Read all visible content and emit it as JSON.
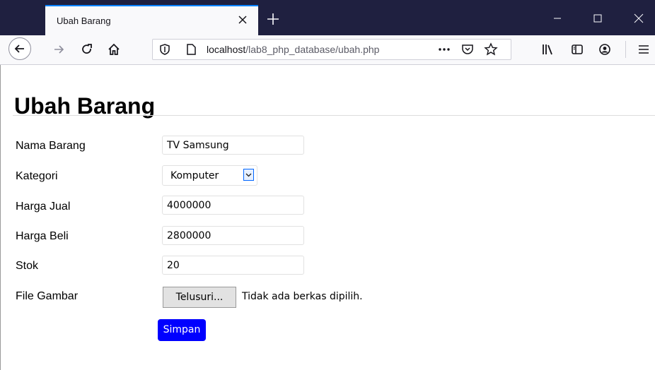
{
  "browser": {
    "tab_title": "Ubah Barang",
    "url_host": "localhost",
    "url_path": "/lab8_php_database/ubah.php",
    "accent_color": "#0a84ff",
    "titlebar_color": "#1f2040"
  },
  "page": {
    "title": "Ubah Barang",
    "form": {
      "nama_label": "Nama Barang",
      "nama_value": "TV Samsung",
      "kategori_label": "Kategori",
      "kategori_value": "Komputer",
      "harga_jual_label": "Harga Jual",
      "harga_jual_value": "4000000",
      "harga_beli_label": "Harga Beli",
      "harga_beli_value": "2800000",
      "stok_label": "Stok",
      "stok_value": "20",
      "file_label": "File Gambar",
      "file_button": "Telusuri...",
      "file_status": "Tidak ada berkas dipilih.",
      "submit_label": "Simpan",
      "submit_color": "#0000ff"
    }
  },
  "icons": {
    "back": "back-arrow-icon",
    "forward": "forward-arrow-icon",
    "reload": "reload-icon",
    "home": "home-icon",
    "tracking": "shield-icon",
    "page": "page-icon",
    "more": "more-dots-icon",
    "pocket": "pocket-icon",
    "bookmark": "star-icon",
    "library": "library-icon",
    "sidebar": "sidebar-icon",
    "account": "account-icon",
    "menu": "hamburger-menu-icon"
  }
}
